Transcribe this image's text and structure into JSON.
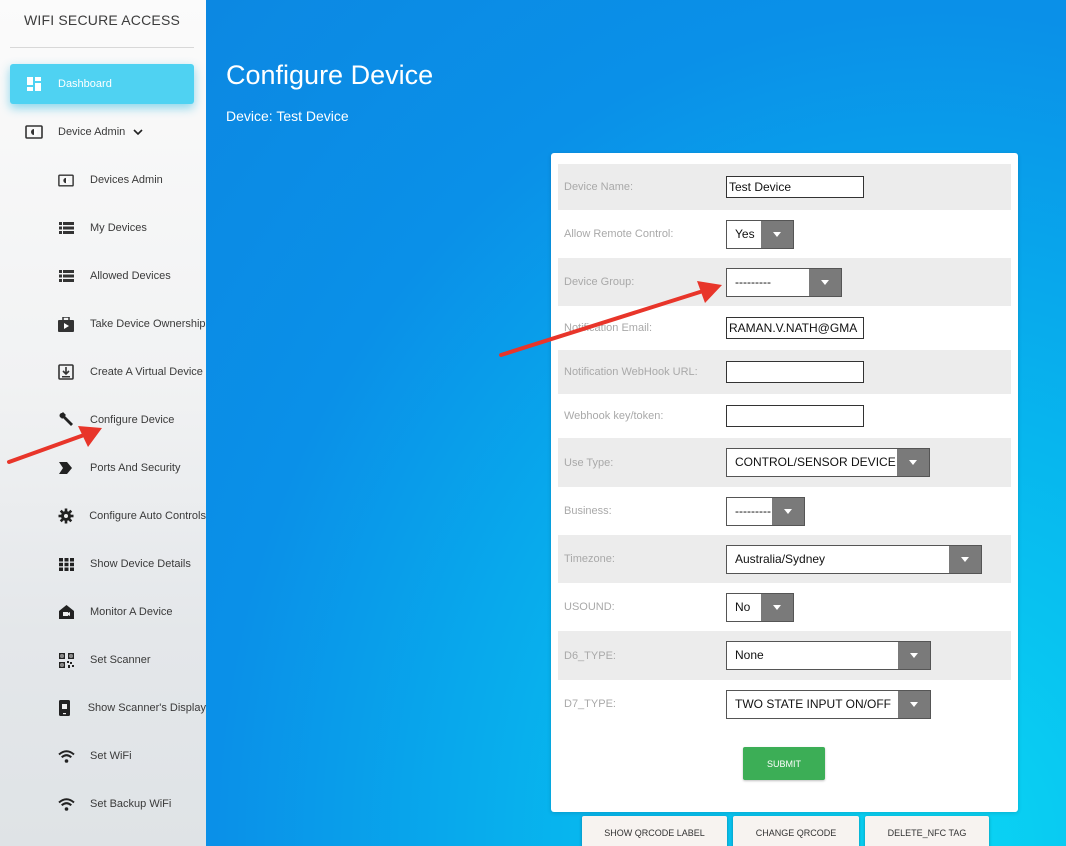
{
  "sidebar": {
    "brand": "WIFI SECURE ACCESS",
    "items": [
      {
        "label": "Dashboard",
        "icon": "dashboard-icon"
      },
      {
        "label": "Device Admin",
        "icon": "device-admin-icon",
        "caret": "chevron-down-icon"
      },
      {
        "label": "Devices Admin",
        "icon": "device-admin-icon"
      },
      {
        "label": "My Devices",
        "icon": "list-icon"
      },
      {
        "label": "Allowed Devices",
        "icon": "list-icon"
      },
      {
        "label": "Take Device Ownership",
        "icon": "briefcase-icon"
      },
      {
        "label": "Create A Virtual Device",
        "icon": "download-box-icon"
      },
      {
        "label": "Configure Device",
        "icon": "wrench-icon"
      },
      {
        "label": "Ports And Security",
        "icon": "label-arrow-icon"
      },
      {
        "label": "Configure Auto Controls",
        "icon": "gear-icon"
      },
      {
        "label": "Show Device Details",
        "icon": "grid-icon"
      },
      {
        "label": "Monitor A Device",
        "icon": "home-camera-icon"
      },
      {
        "label": "Set Scanner",
        "icon": "qrcode-icon"
      },
      {
        "label": "Show Scanner's Display",
        "icon": "phone-display-icon"
      },
      {
        "label": "Set WiFi",
        "icon": "wifi-icon"
      },
      {
        "label": "Set Backup WiFi",
        "icon": "wifi-icon"
      }
    ]
  },
  "main": {
    "title": "Configure Device",
    "subtitle": "Device: Test Device"
  },
  "form": {
    "device_name": {
      "label": "Device Name:",
      "value": "Test Device"
    },
    "allow_remote": {
      "label": "Allow Remote Control:",
      "value": "Yes"
    },
    "device_group": {
      "label": "Device Group:",
      "value": "---------"
    },
    "notification_email": {
      "label": "Notification Email:",
      "value": "RAMAN.V.NATH@GMA"
    },
    "webhook_url": {
      "label": "Notification WebHook URL:",
      "value": ""
    },
    "webhook_key": {
      "label": "Webhook key/token:",
      "value": ""
    },
    "use_type": {
      "label": "Use Type:",
      "value": "CONTROL/SENSOR DEVICE"
    },
    "business": {
      "label": "Business:",
      "value": "---------"
    },
    "timezone": {
      "label": "Timezone:",
      "value": "Australia/Sydney"
    },
    "usound": {
      "label": "USOUND:",
      "value": "No"
    },
    "d6_type": {
      "label": "D6_TYPE:",
      "value": "None"
    },
    "d7_type": {
      "label": "D7_TYPE:",
      "value": "TWO STATE INPUT ON/OFF"
    },
    "submit_label": "SUBMIT"
  },
  "actions": {
    "show_qrcode_label": "SHOW QRCODE LABEL",
    "change_qrcode": "CHANGE QRCODE",
    "delete_nfc_tag": "DELETE_NFC TAG"
  },
  "colors": {
    "sidebar_active": "#4fd2f2",
    "main_background": "#0a90e8",
    "submit_button": "#3cae56",
    "annotation_arrow": "#e8352a",
    "select_arrow_box": "#7a7a7a"
  }
}
